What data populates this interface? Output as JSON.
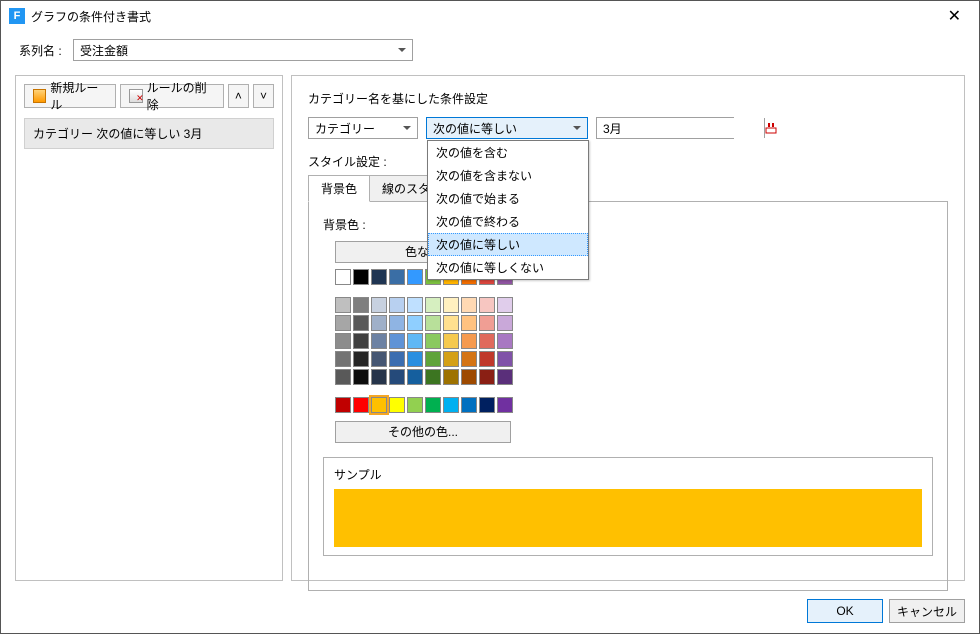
{
  "title": "グラフの条件付き書式",
  "series": {
    "label": "系列名 :",
    "value": "受注金額"
  },
  "toolbar": {
    "new": "新規ルール",
    "del": "ルールの削除"
  },
  "rule_list": [
    "カテゴリー 次の値に等しい 3月"
  ],
  "cond": {
    "heading": "カテゴリー名を基にした条件設定",
    "category": "カテゴリー",
    "operator": "次の値に等しい",
    "value": "3月",
    "options": [
      "次の値を含む",
      "次の値を含まない",
      "次の値で始まる",
      "次の値で終わる",
      "次の値に等しい",
      "次の値に等しくない"
    ]
  },
  "style_label": "スタイル設定 :",
  "tabs": {
    "bg": "背景色",
    "line": "線のスタイル"
  },
  "palette": {
    "label": "背景色 :",
    "nocolor": "色なし",
    "more": "その他の色...",
    "row1": [
      "#ffffff",
      "#000000",
      "#1f3552",
      "#3a6ea5",
      "#3399ff",
      "#7bbf3f",
      "#ffb400",
      "#f06c00",
      "#d9453d",
      "#8f53a1"
    ],
    "grid": [
      [
        "#bfbfbf",
        "#7f7f7f",
        "#c7d1e0",
        "#b8d0f0",
        "#bfe0ff",
        "#d6efc0",
        "#fff0c0",
        "#ffd9b3",
        "#f7c6c1",
        "#e0cdeb"
      ],
      [
        "#a6a6a6",
        "#595959",
        "#9fb0c9",
        "#8fb4e3",
        "#8fcfff",
        "#b8e09a",
        "#ffe08f",
        "#ffc280",
        "#f09e94",
        "#c9a8d9"
      ],
      [
        "#8c8c8c",
        "#404040",
        "#6d82a3",
        "#5f93d6",
        "#5fb8f5",
        "#8ac95f",
        "#f5c94f",
        "#f59a4f",
        "#e06a5c",
        "#a878c2"
      ],
      [
        "#737373",
        "#262626",
        "#455672",
        "#3c6eb0",
        "#2a8fe0",
        "#5fa33a",
        "#d4a017",
        "#d47414",
        "#c0392b",
        "#8052a8"
      ],
      [
        "#595959",
        "#0d0d0d",
        "#26344a",
        "#254a7a",
        "#155f9e",
        "#3c7521",
        "#9e7200",
        "#9e4a00",
        "#8a1f14",
        "#5a2f7a"
      ]
    ],
    "row3": [
      "#c00000",
      "#ff0000",
      "#ffc000",
      "#ffff00",
      "#92d050",
      "#00b050",
      "#00b0f0",
      "#0070c0",
      "#002060",
      "#7030a0"
    ],
    "selected": "#ffc000"
  },
  "sample_label": "サンプル",
  "buttons": {
    "ok": "OK",
    "cancel": "キャンセル"
  }
}
